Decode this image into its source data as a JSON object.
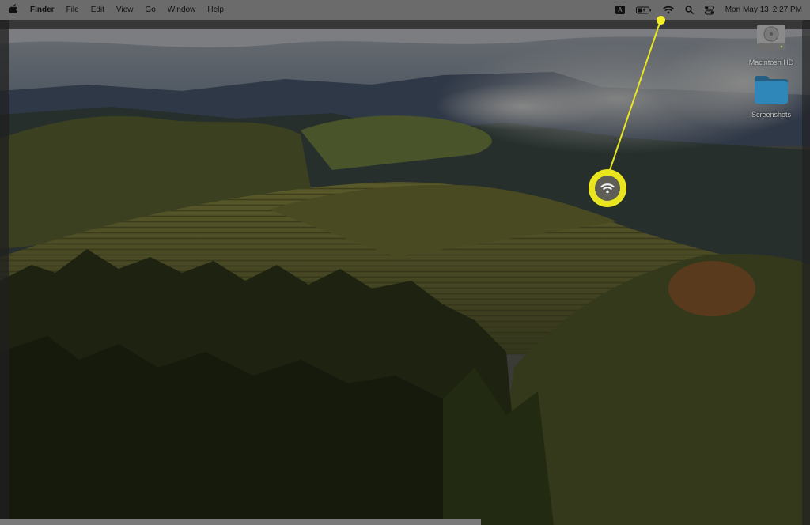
{
  "menubar": {
    "apple_icon": "apple-logo-icon",
    "app_name": "Finder",
    "menus": [
      "File",
      "Edit",
      "View",
      "Go",
      "Window",
      "Help"
    ],
    "input_source_badge": "A",
    "status_icons": [
      "keyboard-input-icon",
      "battery-icon",
      "wifi-icon",
      "search-icon",
      "control-center-icon"
    ],
    "clock": {
      "date": "Mon May 13",
      "time": "2:27 PM"
    }
  },
  "desktop": {
    "icons": [
      {
        "label": "Macintosh HD",
        "icon": "hard-drive-icon"
      },
      {
        "label": "Screenshots",
        "icon": "folder-icon"
      }
    ]
  },
  "callout": {
    "target_icon": "wifi-icon",
    "color": "#e9e61f"
  },
  "colors": {
    "menubar_bg": "#6b6b6b",
    "folder_blue": "#2f86b8",
    "highlight_yellow": "#e9e61f"
  }
}
